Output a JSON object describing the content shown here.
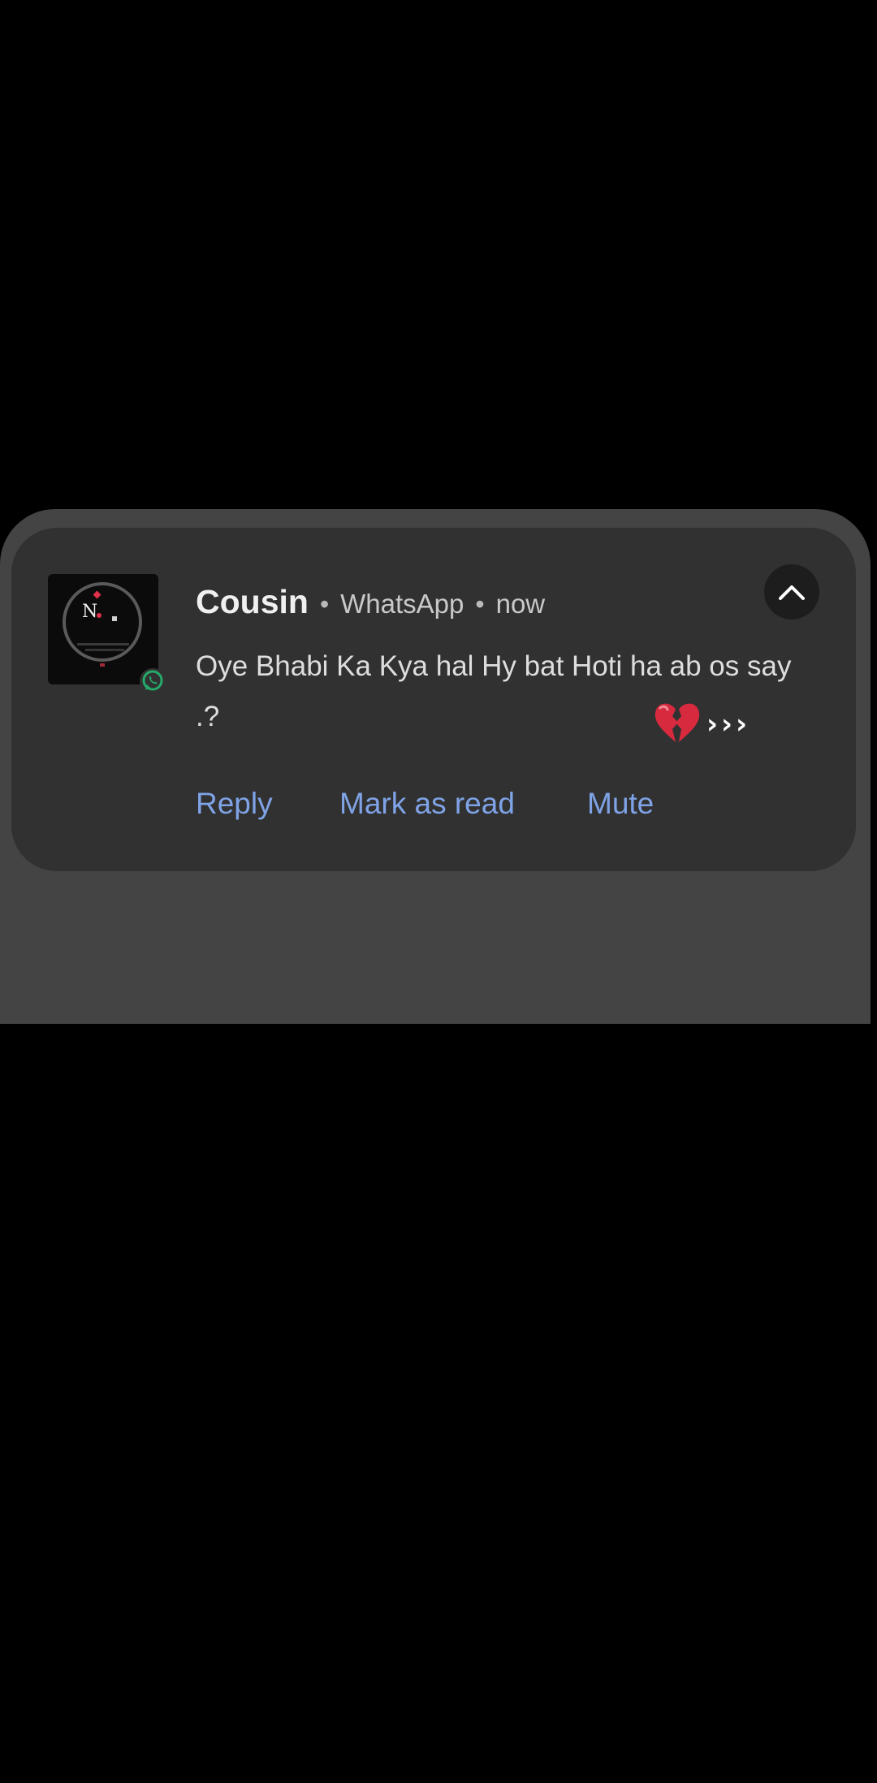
{
  "notification": {
    "sender": "Cousin",
    "separator": "•",
    "app_name": "WhatsApp",
    "time": "now",
    "message": "Oye Bhabi Ka Kya hal Hy bat Hoti ha ab os say .?",
    "emoji_icon": "broken-heart-emoji",
    "trailing_arrows": "›››",
    "avatar_letter": "N",
    "app_badge_icon": "whatsapp-icon",
    "expand_icon": "chevron-up-icon",
    "actions": [
      {
        "label": "Reply"
      },
      {
        "label": "Mark as read"
      },
      {
        "label": "Mute"
      }
    ]
  },
  "colors": {
    "background": "#000000",
    "shade_panel": "#444444",
    "card": "#313131",
    "action_text": "#7fa3e6",
    "whatsapp_green": "#25a86a"
  }
}
